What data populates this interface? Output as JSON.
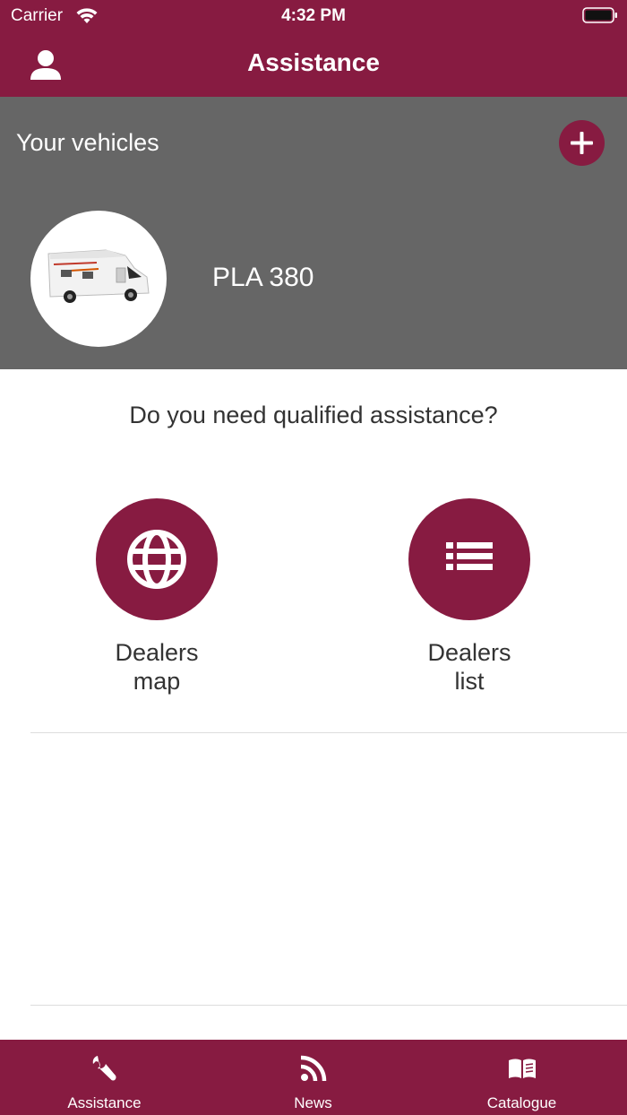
{
  "status_bar": {
    "carrier": "Carrier",
    "time": "4:32 PM",
    "icons": [
      "wifi-icon",
      "battery-icon"
    ]
  },
  "nav": {
    "title": "Assistance",
    "left_icon": "user-icon"
  },
  "vehicles": {
    "title": "Your vehicles",
    "add_icon": "plus-icon",
    "items": [
      {
        "name": "PLA 380",
        "image": "motorhome-photo"
      }
    ]
  },
  "assistance": {
    "question": "Do you need qualified assistance?",
    "actions": [
      {
        "label_line1": "Dealers",
        "label_line2": "map",
        "icon": "globe-icon"
      },
      {
        "label_line1": "Dealers",
        "label_line2": "list",
        "icon": "list-icon"
      }
    ]
  },
  "tabbar": {
    "tabs": [
      {
        "label": "Assistance",
        "icon": "wrench-icon",
        "selected": true
      },
      {
        "label": "News",
        "icon": "rss-icon",
        "selected": false
      },
      {
        "label": "Catalogue",
        "icon": "book-icon",
        "selected": false
      }
    ]
  },
  "colors": {
    "brand": "#871b41",
    "vehicles_background": "#666666",
    "text": "#333333",
    "divider": "#dddddd"
  }
}
